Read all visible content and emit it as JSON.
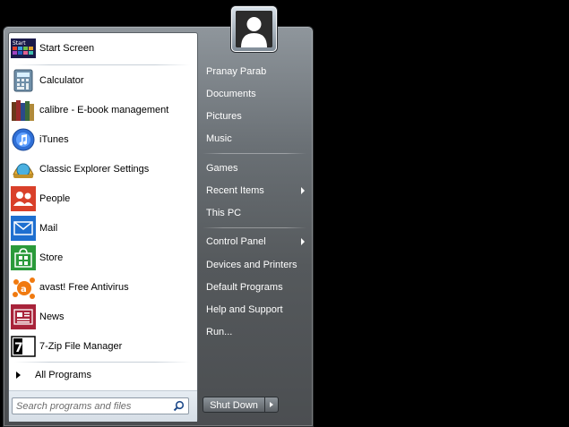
{
  "programs": [
    {
      "label": "Start Screen",
      "icon": "start-screen-icon"
    },
    {
      "label": "Calculator",
      "icon": "calculator-icon"
    },
    {
      "label": "calibre - E-book management",
      "icon": "calibre-icon"
    },
    {
      "label": "iTunes",
      "icon": "itunes-icon"
    },
    {
      "label": "Classic Explorer Settings",
      "icon": "shell-icon"
    },
    {
      "label": "People",
      "icon": "people-icon"
    },
    {
      "label": "Mail",
      "icon": "mail-icon"
    },
    {
      "label": "Store",
      "icon": "store-icon"
    },
    {
      "label": "avast! Free Antivirus",
      "icon": "avast-icon"
    },
    {
      "label": "News",
      "icon": "news-icon"
    },
    {
      "label": "7-Zip File Manager",
      "icon": "7zip-icon"
    }
  ],
  "start_icon_text": "Start",
  "all_programs": "All Programs",
  "search": {
    "placeholder": "Search programs and files"
  },
  "right_panel": {
    "user": "Pranay Parab",
    "documents": "Documents",
    "pictures": "Pictures",
    "music": "Music",
    "games": "Games",
    "recent_items": "Recent Items",
    "this_pc": "This PC",
    "control_panel": "Control Panel",
    "devices_printers": "Devices and Printers",
    "default_programs": "Default Programs",
    "help_support": "Help and Support",
    "run": "Run..."
  },
  "shutdown": {
    "label": "Shut Down"
  },
  "seven_zip_text": "7z",
  "colors": {
    "accent": "#1e6fd0",
    "store_green": "#2a9a3a",
    "people_red": "#d9402a",
    "news_red": "#a8233a"
  }
}
